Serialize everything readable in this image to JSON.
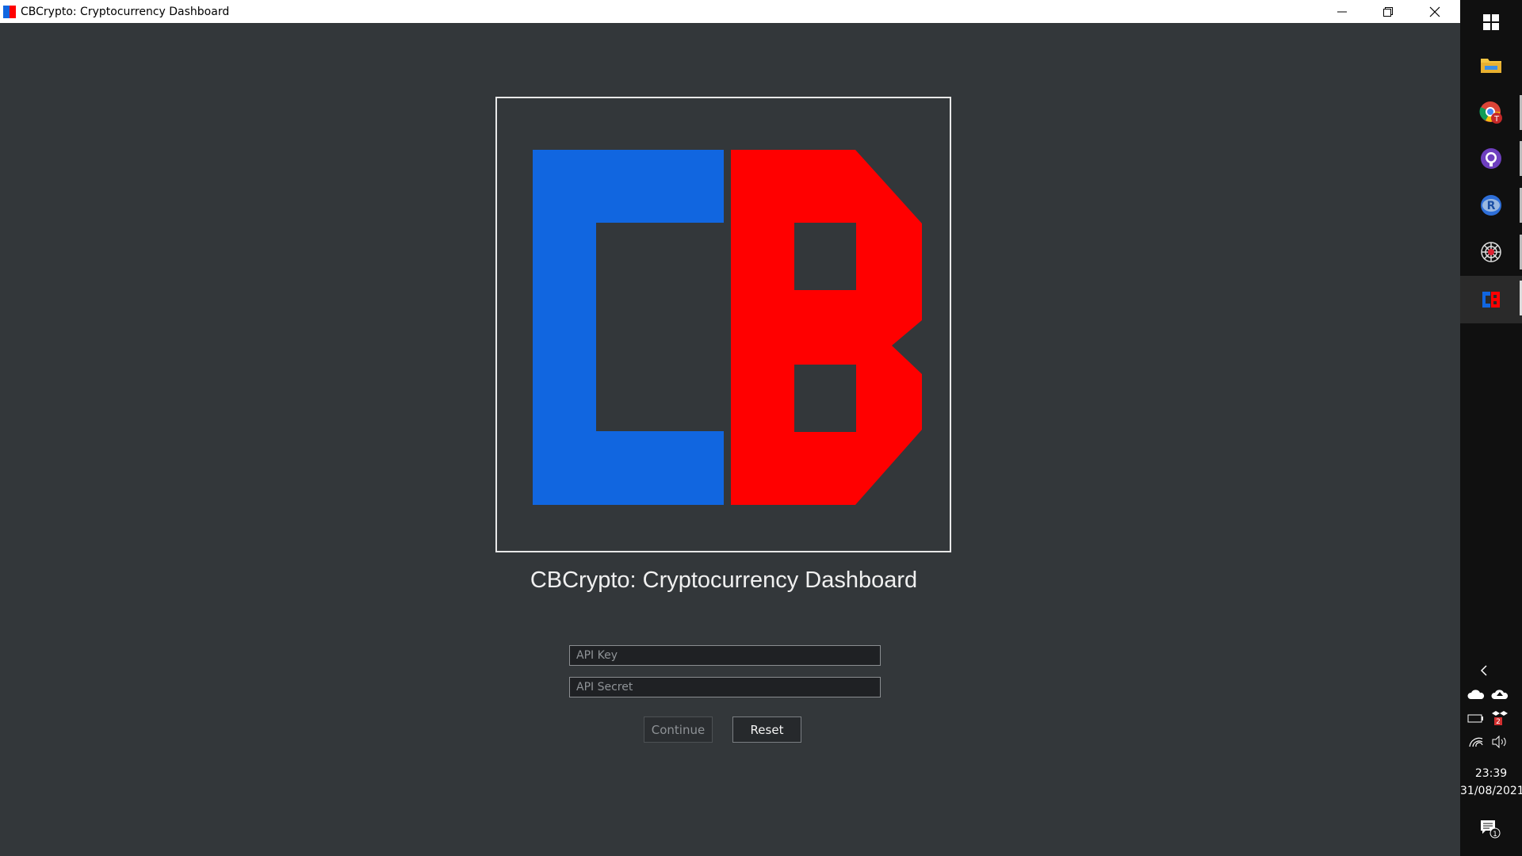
{
  "window": {
    "title": "CBCrypto: Cryptocurrency Dashboard",
    "background": "#33373a"
  },
  "logo": {
    "letters": "CB",
    "colors": {
      "c": "#1166e0",
      "b": "#ff0000"
    }
  },
  "main": {
    "heading": "CBCrypto: Cryptocurrency Dashboard",
    "api_key_placeholder": "API Key",
    "api_key_value": "",
    "api_secret_placeholder": "API Secret",
    "api_secret_value": "",
    "continue_label": "Continue",
    "reset_label": "Reset"
  },
  "taskbar": {
    "apps": [
      {
        "name": "start",
        "icon": "windows-logo-icon"
      },
      {
        "name": "file-explorer",
        "icon": "folder-icon"
      },
      {
        "name": "chrome",
        "icon": "chrome-icon"
      },
      {
        "name": "github-desktop",
        "icon": "github-icon"
      },
      {
        "name": "r",
        "icon": "r-icon"
      },
      {
        "name": "spider",
        "icon": "spider-web-icon"
      },
      {
        "name": "cbcrypto",
        "icon": "cb-logo-icon"
      }
    ],
    "tray": {
      "notification_badge": "2",
      "action_center_count": "1"
    },
    "clock": {
      "time": "23:39",
      "date": "31/08/2021"
    }
  }
}
